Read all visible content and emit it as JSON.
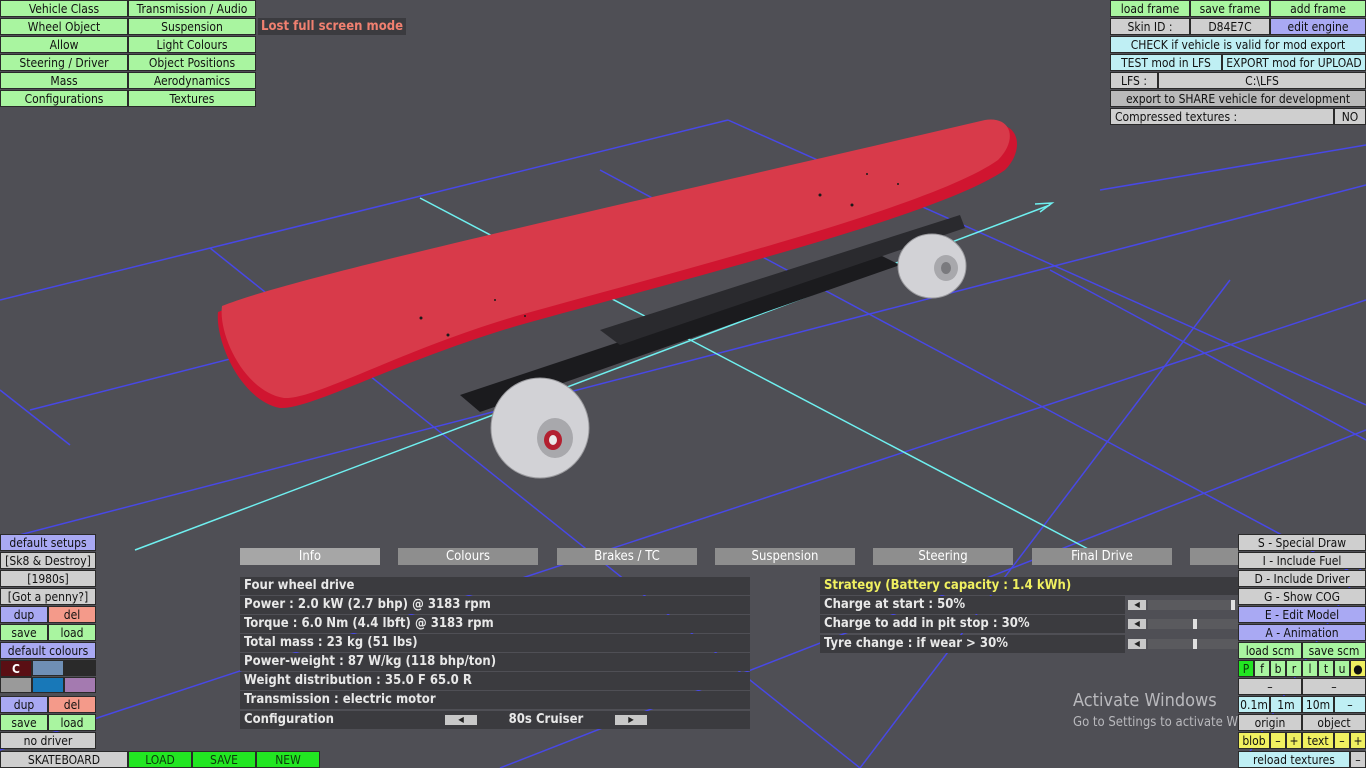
{
  "top_menu": {
    "vehicle_class": "Vehicle Class",
    "transmission_audio": "Transmission / Audio",
    "wheel_object": "Wheel Object",
    "suspension": "Suspension",
    "allow": "Allow",
    "light_colours": "Light Colours",
    "steering_driver": "Steering / Driver",
    "object_positions": "Object Positions",
    "mass": "Mass",
    "aerodynamics": "Aerodynamics",
    "configurations": "Configurations",
    "textures": "Textures"
  },
  "status_message": "Lost full screen mode",
  "right_panel": {
    "load_frame": "load frame",
    "save_frame": "save frame",
    "add_frame": "add frame",
    "skin_id_label": "Skin ID :",
    "skin_id_value": "D84E7C",
    "edit_engine": "edit engine",
    "check_valid": "CHECK if vehicle is valid for mod export",
    "test_mod": "TEST mod in LFS",
    "export_mod": "EXPORT mod for UPLOAD",
    "lfs_label": "LFS :",
    "lfs_path": "C:\\LFS",
    "export_share": "export to SHARE vehicle for development",
    "compressed_label": "Compressed textures :",
    "compressed_value": "NO"
  },
  "left_panel": {
    "default_setups": "default setups",
    "setup_name": "[Sk8 & Destroy]",
    "setup_era": "[1980s]",
    "setup_tagline": "[Got a penny?]",
    "dup": "dup",
    "del": "del",
    "save": "save",
    "load": "load",
    "default_colours": "default colours",
    "colour_c": "C",
    "dup2": "dup",
    "del2": "del",
    "save2": "save",
    "load2": "load",
    "no_driver": "no driver",
    "vehicle_name": "SKATEBOARD",
    "load_btn": "LOAD",
    "save_btn": "SAVE",
    "new_btn": "NEW"
  },
  "tabs": [
    "Info",
    "Colours",
    "Brakes / TC",
    "Suspension",
    "Steering",
    "Final Drive"
  ],
  "info": {
    "drive": "Four wheel drive",
    "power": "Power : 2.0 kW (2.7 bhp) @ 3183 rpm",
    "torque": "Torque : 6.0 Nm (4.4 lbft) @ 3183 rpm",
    "mass": "Total mass : 23 kg (51 lbs)",
    "power_weight": "Power-weight : 87 W/kg (118 bhp/ton)",
    "weight_dist": "Weight distribution : 35.0 F  65.0 R",
    "transmission": "Transmission : electric motor",
    "config_label": "Configuration",
    "config_value": "80s Cruiser"
  },
  "strategy": {
    "title": "Strategy (Battery capacity : 1.4 kWh)",
    "charge_start": "Charge at start : 50%",
    "charge_pit": "Charge to add in pit stop : 30%",
    "tyre_change": "Tyre change : if wear > 30%",
    "charge_start_level": 0.96,
    "charge_pit_level": 0.52,
    "tyre_change_level": 0.52
  },
  "tools": {
    "special_draw": "S - Special Draw",
    "include_fuel": "I - Include Fuel",
    "include_driver": "D - Include Driver",
    "show_cog": "G - Show COG",
    "edit_model": "E - Edit Model",
    "animation": "A - Animation",
    "load_scm": "load scm",
    "save_scm": "save scm",
    "letters": [
      "P",
      "f",
      "b",
      "r",
      "l",
      "t",
      "u",
      "●"
    ],
    "minus1": "–",
    "minus2": "–",
    "step_01": "0.1m",
    "step_1": "1m",
    "step_10": "10m",
    "step_minus": "–",
    "origin": "origin",
    "object": "object",
    "blob": "blob",
    "blob_minus": "–",
    "blob_plus": "+",
    "text": "text",
    "text_minus": "–",
    "text_plus": "+",
    "reload_textures": "reload textures",
    "reload_minus": "–"
  },
  "watermark": {
    "title": "Activate Windows",
    "subtitle": "Go to Settings to activate Windows."
  },
  "colors": {
    "background": "#4f4f55",
    "deck": "#d83a4a",
    "grid": "#4848e6",
    "axis": "#6ff0f0"
  }
}
